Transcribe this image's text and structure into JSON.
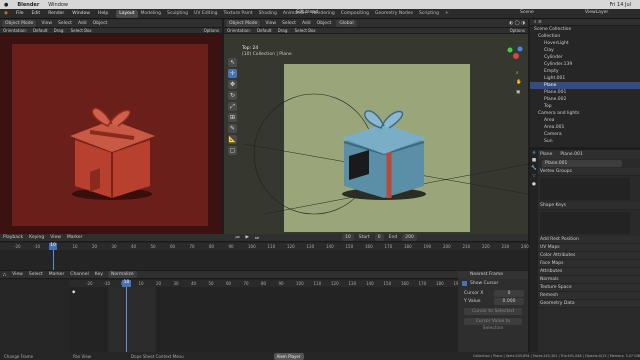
{
  "mac": {
    "app": "Blender",
    "menu1": "Window",
    "clock": "Fri 14 Jul"
  },
  "top": {
    "menus": [
      "File",
      "Edit",
      "Render",
      "Window",
      "Help"
    ],
    "workspaces": [
      "Layout",
      "Modeling",
      "Sculpting",
      "UV Editing",
      "Texture Paint",
      "Shading",
      "Animation",
      "Rendering",
      "Compositing",
      "Geometry Nodes",
      "Scripting"
    ],
    "file_title": "Gift.blend",
    "scene": "Scene",
    "view_layer": "ViewLayer"
  },
  "left_vp": {
    "mode": "Object Mode",
    "menus": [
      "View",
      "Select",
      "Add",
      "Object"
    ],
    "orientation_label": "Orientation:",
    "orientation": "Default",
    "drag_label": "Drag:",
    "drag": "Select Box",
    "options": "Options"
  },
  "right_vp": {
    "mode": "Object Mode",
    "menus": [
      "View",
      "Select",
      "Add",
      "Object"
    ],
    "transform": "Global",
    "orientation_label": "Orientation:",
    "orientation": "Default",
    "drag_label": "Drag:",
    "drag": "Select Box",
    "options": "Options",
    "overlay_title": "Top: 24",
    "overlay_sub": "(10) Collection | Plane"
  },
  "outliner": {
    "title": "Scene Collection",
    "items": [
      "Collection",
      "HoverLight",
      "Clay",
      "Cylinder",
      "Cylinder.139",
      "Empty",
      "Light.001",
      "Plane",
      "Plane.001",
      "Plane.002",
      "Top",
      "Camera and lights",
      "Area",
      "Area.001",
      "Camera",
      "Sun"
    ]
  },
  "props": {
    "object": "Plane",
    "data": "Plane.001",
    "sections": [
      "Vertex Groups",
      "Shape Keys",
      "UV Maps",
      "Color Attributes",
      "Face Maps",
      "Attributes",
      "Normals",
      "Texture Space",
      "Remesh",
      "Geometry Data"
    ],
    "attr_label": "Add Rest Position"
  },
  "timeline": {
    "menus": [
      "Playback",
      "Keying",
      "View",
      "Marker"
    ],
    "current": "10",
    "start_label": "Start",
    "start": "0",
    "end_label": "End",
    "end": "200",
    "ticks": [
      "-20",
      "-10",
      "0",
      "10",
      "20",
      "30",
      "40",
      "50",
      "60",
      "70",
      "80",
      "90",
      "100",
      "110",
      "120",
      "130",
      "140",
      "150",
      "160",
      "170",
      "180",
      "190",
      "200",
      "210",
      "220",
      "230",
      "240"
    ]
  },
  "dopesheet": {
    "menus": [
      "View",
      "Select",
      "Marker",
      "Channel",
      "Key"
    ],
    "normalize": "Normalize",
    "ticks": [
      "-20",
      "-10",
      "0",
      "10",
      "20",
      "30",
      "40",
      "50",
      "60",
      "70",
      "80",
      "90",
      "100",
      "110",
      "120",
      "130",
      "140",
      "150",
      "160",
      "170",
      "180",
      "190",
      "200"
    ],
    "cursor_frame": "10",
    "side_title": "Nearest Frame",
    "show_cursor": "Show Cursor",
    "cursor_x_label": "Cursor X",
    "cursor_x": "0",
    "cursor_y_label": "Y Value",
    "cursor_y": "0.000",
    "btn1": "Cursor to Selected",
    "btn2": "Cursor Value to Selection"
  },
  "status": {
    "left": "Change Frame",
    "pan": "Pan View",
    "ctx": "Dope Sheet Context Menu",
    "right_btn": "Alem Player",
    "stats": "Collection | Plane | Verts:245,894 | Faces:245,302 | Tris:491,048 | Objects:0/13 | Memory: 3.07 GiB"
  },
  "colors": {
    "accent": "#4772b3",
    "cursor": "#5d8ed8",
    "gift_red": "#b8402e",
    "gift_blue": "#5b8fa8"
  }
}
